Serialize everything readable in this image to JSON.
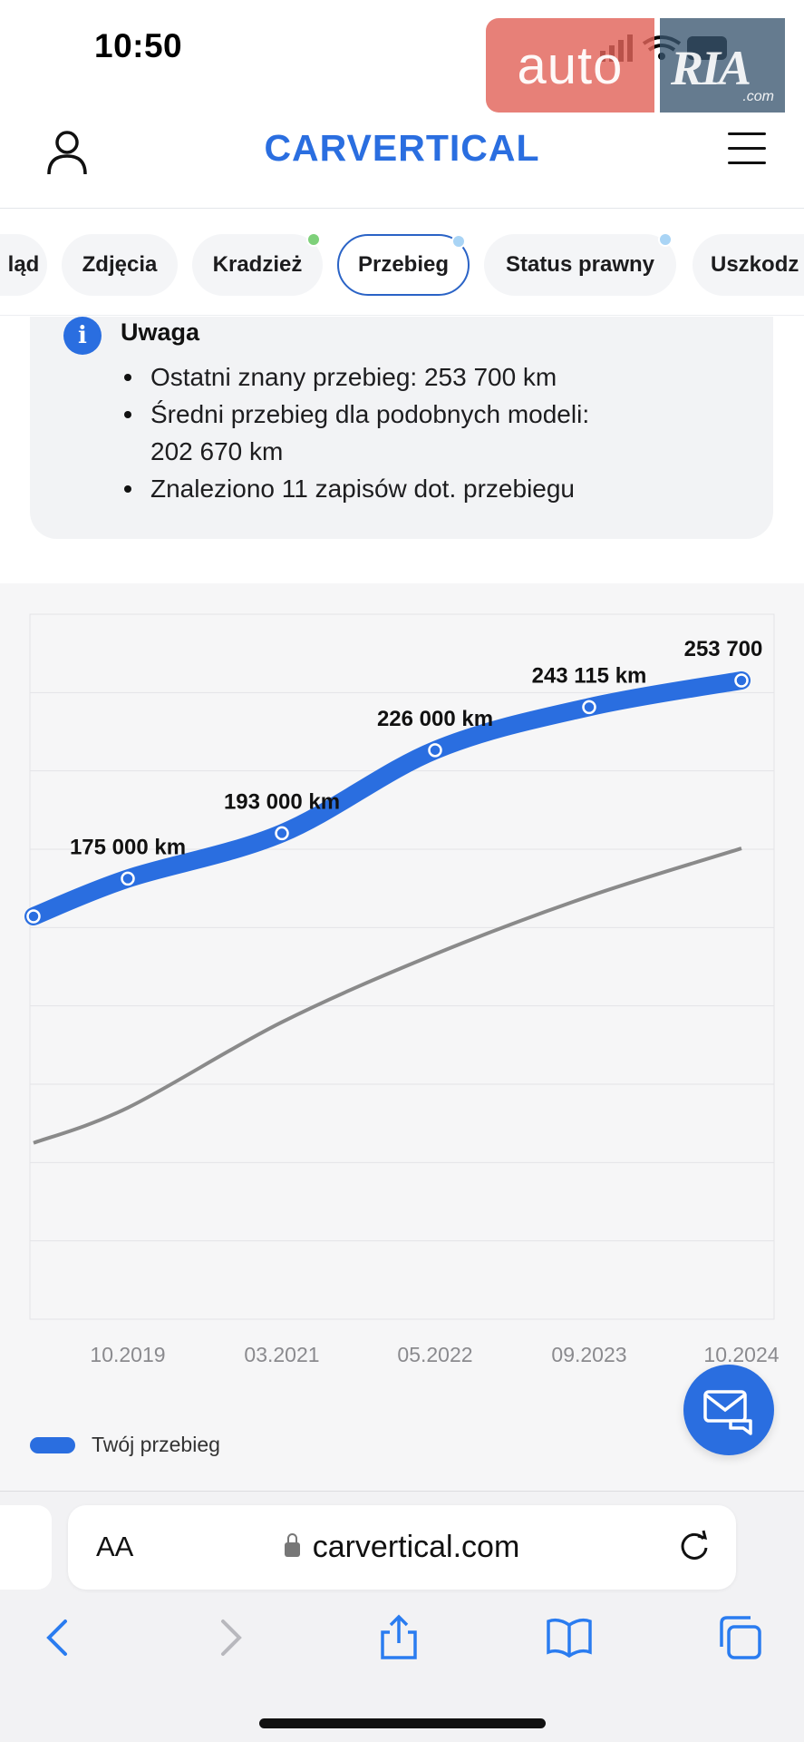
{
  "status": {
    "time": "10:50"
  },
  "watermark": {
    "left": "auto",
    "right": "RIA",
    "suffix": ".com"
  },
  "header": {
    "logo": "CARVERTICAL"
  },
  "tabs": [
    {
      "label": "ląd",
      "dot": null
    },
    {
      "label": "Zdjęcia",
      "dot": null
    },
    {
      "label": "Kradzież",
      "dot": "#7ed07a"
    },
    {
      "label": "Przebieg",
      "dot": "#a9d4f5",
      "active": true
    },
    {
      "label": "Status prawny",
      "dot": "#a9d4f5"
    },
    {
      "label": "Uszkodz",
      "dot": null
    }
  ],
  "notice": {
    "title": "Uwaga",
    "items": [
      "Ostatni znany przebieg: 253 700 km",
      "Średni przebieg dla podobnych modeli:",
      "202 670 km",
      "Znaleziono 11 zapisów dot. przebiegu"
    ]
  },
  "chart_data": {
    "type": "line",
    "x_tick_labels": [
      "10.2019",
      "03.2021",
      "05.2022",
      "09.2023",
      "10.2024"
    ],
    "series": [
      {
        "name": "Twój przebieg",
        "color": "#2a6ee0",
        "points": [
          {
            "x": "03.2019",
            "y": 160000,
            "label": ""
          },
          {
            "x": "10.2019",
            "y": 175000,
            "label": "175 000 km"
          },
          {
            "x": "03.2021",
            "y": 193000,
            "label": "193 000 km"
          },
          {
            "x": "05.2022",
            "y": 226000,
            "label": "226 000 km"
          },
          {
            "x": "09.2023",
            "y": 243115,
            "label": "243 115 km"
          },
          {
            "x": "10.2024",
            "y": 253700,
            "label": "253 700"
          }
        ]
      },
      {
        "name": "",
        "color": "#8a8a8a",
        "points": [
          {
            "x": "03.2019",
            "y": 70000
          },
          {
            "x": "10.2019",
            "y": 84000
          },
          {
            "x": "03.2021",
            "y": 118000
          },
          {
            "x": "05.2022",
            "y": 145000
          },
          {
            "x": "09.2023",
            "y": 168000
          },
          {
            "x": "10.2024",
            "y": 187000
          }
        ]
      }
    ],
    "ylim": [
      0,
      280000
    ],
    "grid": true,
    "legend": "bottom-left"
  },
  "legend": {
    "label": "Twój przebieg"
  },
  "browser": {
    "aa": "AA",
    "url": "carvertical.com"
  },
  "colors": {
    "brand": "#2a6ee0",
    "active_tab_border": "#2a63c6"
  }
}
